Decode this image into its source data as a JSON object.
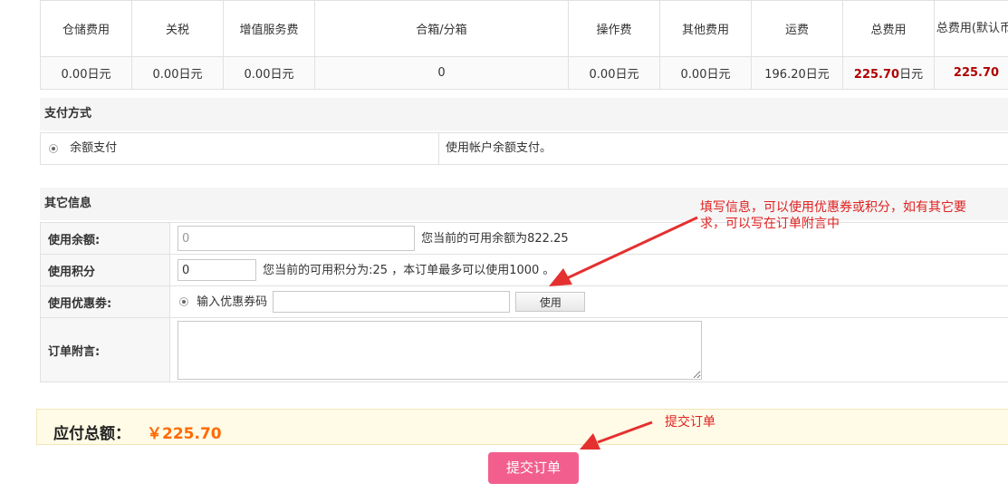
{
  "fees": {
    "headers": [
      "仓储费用",
      "关税",
      "增值服务费",
      "合箱/分箱",
      "操作费",
      "其他费用",
      "运费",
      "总费用",
      "总费用(默认币)"
    ],
    "values": [
      "0.00日元",
      "0.00日元",
      "0.00日元",
      "0",
      "0.00日元",
      "0.00日元",
      "196.20日元",
      "225.70",
      "225.70"
    ],
    "total_unit": "日元"
  },
  "payment": {
    "title": "支付方式",
    "method_label": "余额支付",
    "method_desc": "使用帐户余额支付。"
  },
  "other_info": {
    "title": "其它信息",
    "balance": {
      "label": "使用余额:",
      "value": "0",
      "hint": "您当前的可用余额为822.25"
    },
    "points": {
      "label": "使用积分",
      "value": "0",
      "hint": "您当前的可用积分为:25 ，本订单最多可以使用1000 。"
    },
    "coupon": {
      "label": "使用优惠劵:",
      "option_label": "输入优惠券码",
      "value": "",
      "button": "使用"
    },
    "remark": {
      "label": "订单附言:",
      "value": ""
    }
  },
  "total": {
    "label": "应付总额：",
    "amount": "￥225.70"
  },
  "submit_label": "提交订单",
  "annotations": {
    "note1_line1": "填写信息，可以使用优惠券或积分，如有其它要",
    "note1_line2": "求，可以写在订单附言中",
    "note2": "提交订单"
  },
  "colors": {
    "accent_red": "#b00000",
    "total_orange": "#ff6a00",
    "submit_pink": "#f25f8f",
    "annotation_red": "#e02020"
  }
}
